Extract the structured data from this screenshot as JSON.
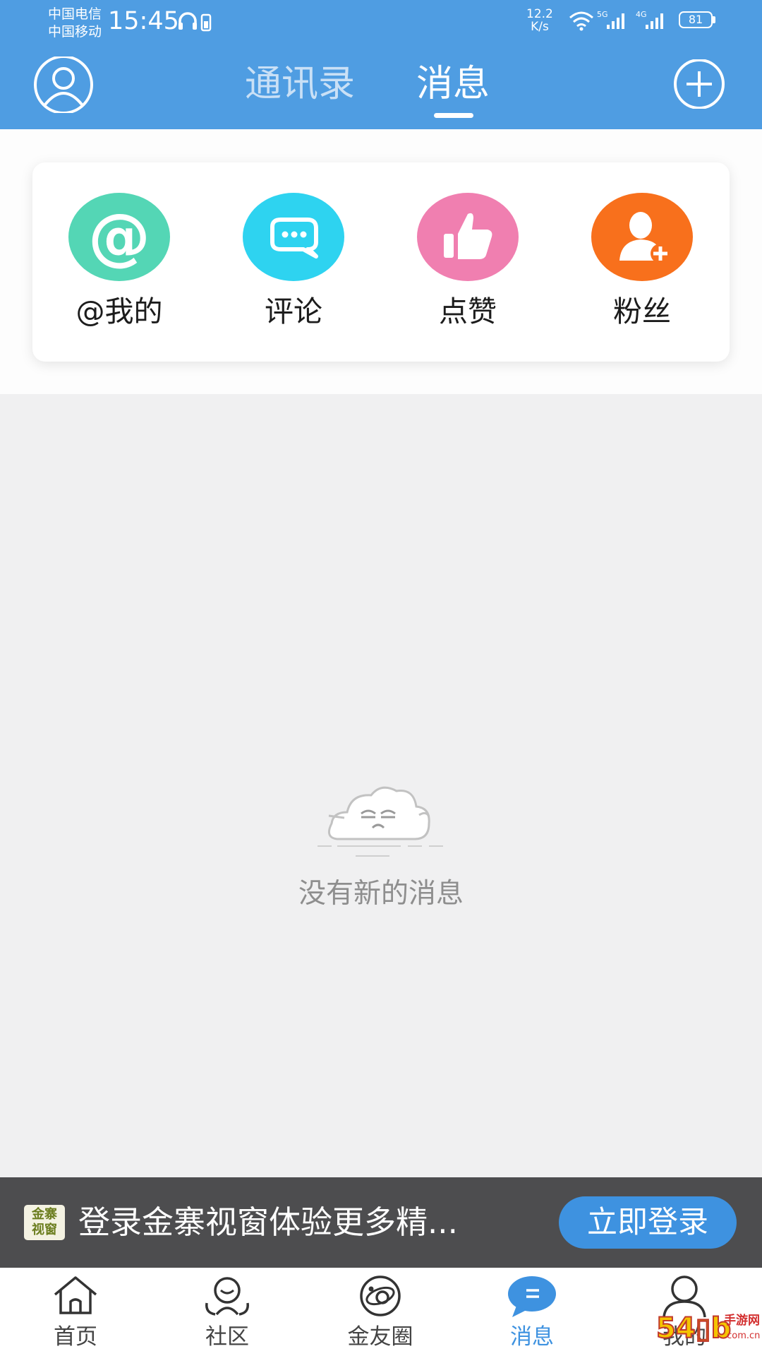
{
  "status_bar": {
    "carrier_1": "中国电信",
    "carrier_2": "中国移动",
    "time": "15:45",
    "net_speed_value": "12.2",
    "net_speed_unit": "K/s",
    "signal_1": "5G",
    "signal_2": "4G",
    "battery": "81"
  },
  "header": {
    "tabs": [
      {
        "label": "通讯录",
        "active": false
      },
      {
        "label": "消息",
        "active": true
      }
    ],
    "avatar_icon": "user-circle-icon",
    "add_icon": "plus-circle-icon"
  },
  "quick_actions": [
    {
      "label": "@我的",
      "icon": "at-icon",
      "color": "#54d6b5"
    },
    {
      "label": "评论",
      "icon": "chat-bubble-icon",
      "color": "#2ed3f0"
    },
    {
      "label": "点赞",
      "icon": "thumbs-up-icon",
      "color": "#f07fb0"
    },
    {
      "label": "粉丝",
      "icon": "add-user-icon",
      "color": "#f8701c"
    }
  ],
  "empty_state": {
    "icon": "sleepy-cloud-icon",
    "text": "没有新的消息"
  },
  "login_bar": {
    "logo_text_1": "金寨",
    "logo_text_2": "视窗",
    "text": "登录金寨视窗体验更多精...",
    "button": "立即登录"
  },
  "bottom_nav": [
    {
      "label": "首页",
      "icon": "home-icon",
      "active": false
    },
    {
      "label": "社区",
      "icon": "community-icon",
      "active": false
    },
    {
      "label": "金友圈",
      "icon": "planet-icon",
      "active": false
    },
    {
      "label": "消息",
      "icon": "message-icon",
      "active": true
    },
    {
      "label": "我的",
      "icon": "profile-icon",
      "active": false
    }
  ],
  "watermark": {
    "text": "54▯b",
    "site": "手游网",
    "domain": ".com.cn"
  },
  "colors": {
    "header": "#4f9de2",
    "accent": "#3e92e0",
    "login_bar": "#4d4d4f",
    "background": "#f0f0f1"
  }
}
